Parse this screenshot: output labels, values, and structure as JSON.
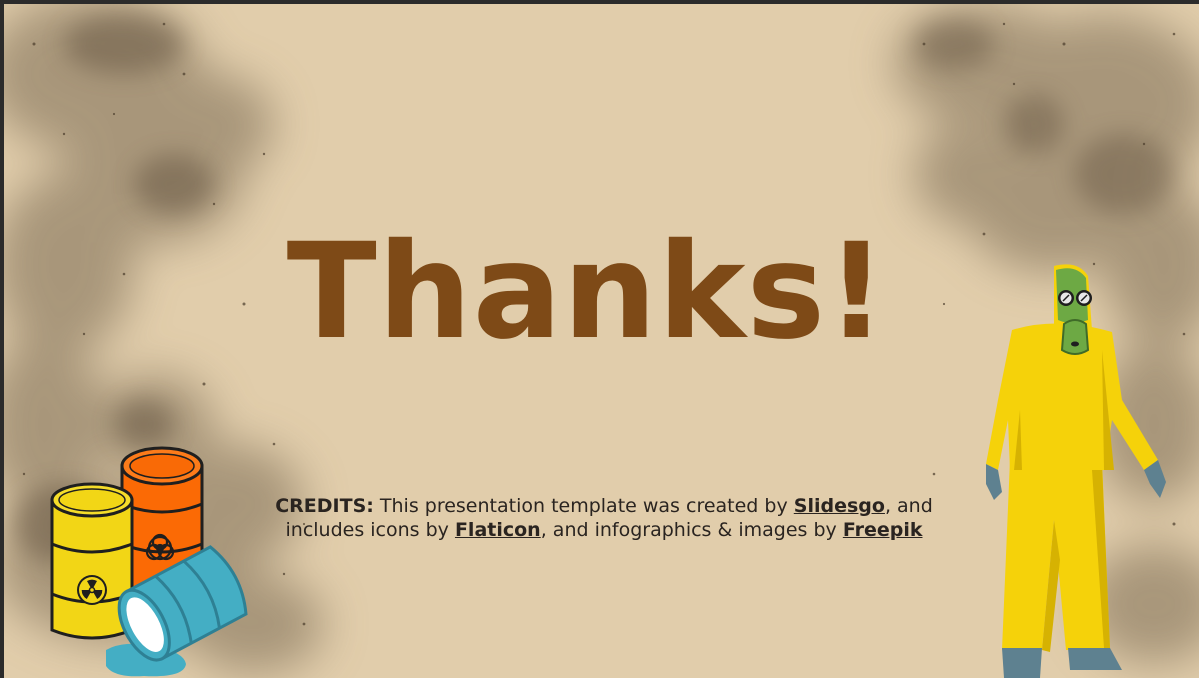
{
  "slide": {
    "title": "Thanks!",
    "credits": {
      "lead": "CREDITS:",
      "text_1": " This presentation template was created by ",
      "link_1": "Slidesgo",
      "text_2": ", and",
      "text_3": "includes icons by ",
      "link_2": "Flaticon",
      "text_4": ", and infographics & images by ",
      "link_3": "Freepik"
    }
  },
  "colors": {
    "background": "#e1cdab",
    "title": "#7e4a17",
    "smoke": "#6b5a43",
    "suit": "#f5d20a",
    "barrel_yellow": "#f2d616",
    "barrel_orange": "#fb6a05",
    "barrel_blue": "#44aec4",
    "gasmask": "#6da944",
    "gloves_boots": "#5e8190"
  },
  "icons": [
    "radiation-icon",
    "biohazard-icon",
    "gas-mask-icon"
  ]
}
